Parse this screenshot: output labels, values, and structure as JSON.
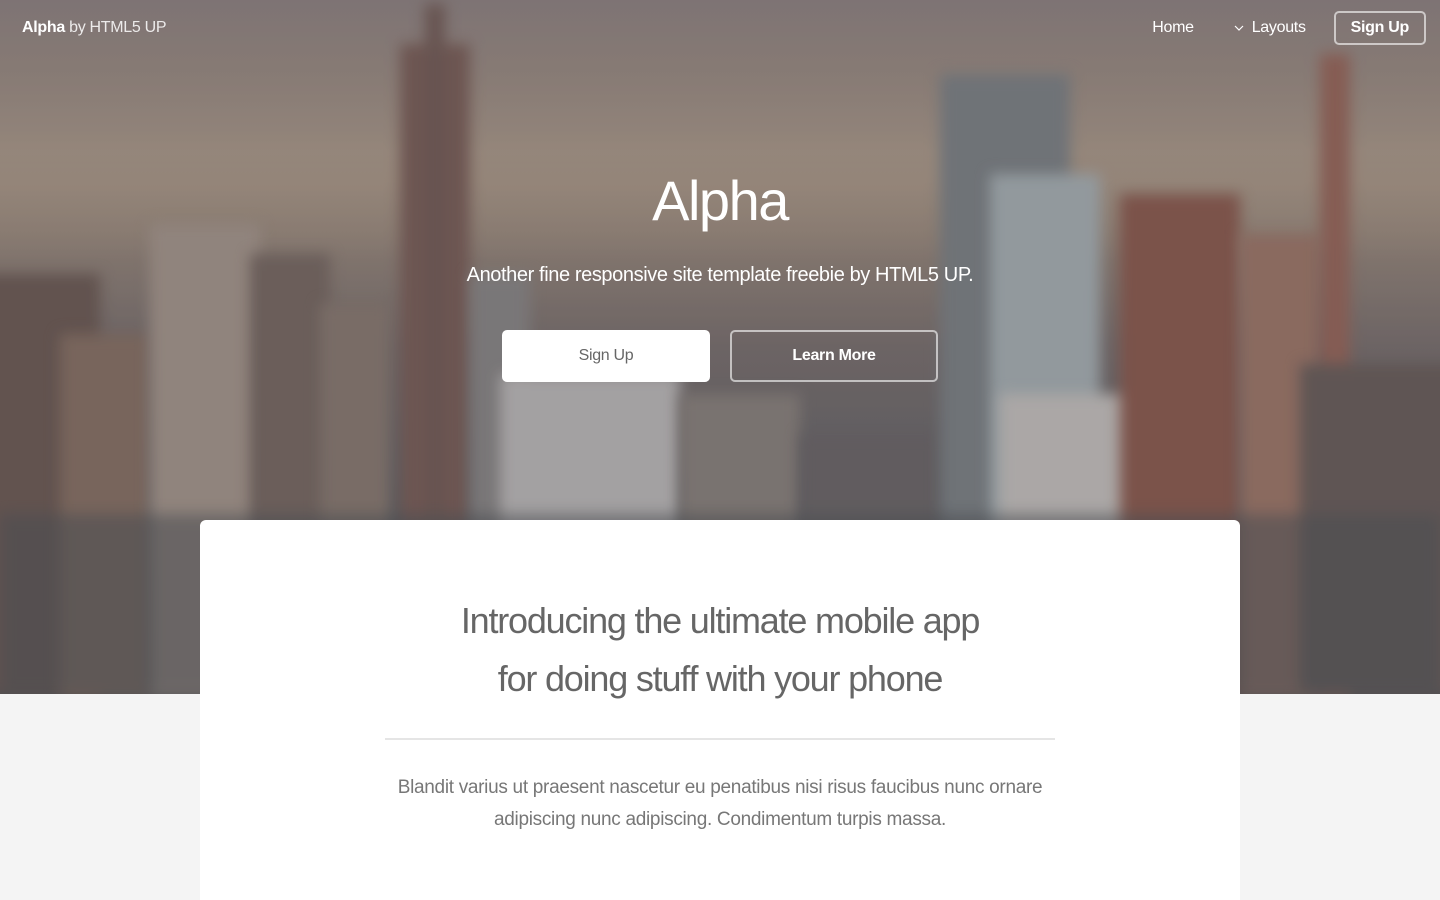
{
  "header": {
    "brand_strong": "Alpha",
    "brand_light": " by HTML5 UP",
    "nav": {
      "home": "Home",
      "layouts": "Layouts",
      "signup": "Sign Up"
    }
  },
  "hero": {
    "title": "Alpha",
    "subtitle": "Another fine responsive site template freebie by HTML5 UP.",
    "buttons": {
      "primary": "Sign Up",
      "secondary": "Learn More"
    }
  },
  "main": {
    "title_line1": "Introducing the ultimate mobile app",
    "title_line2": "for doing stuff with your phone",
    "body_line1": "Blandit varius ut praesent nascetur eu penatibus nisi risus faucibus nunc ornare",
    "body_line2": "adipiscing nunc adipiscing. Condimentum turpis massa."
  },
  "icons": {
    "layouts_dropdown": "chevron-down-icon"
  },
  "colors": {
    "page_background": "#f4f4f4",
    "card_background": "#ffffff",
    "heading_text": "#666666",
    "body_text": "#777777"
  }
}
